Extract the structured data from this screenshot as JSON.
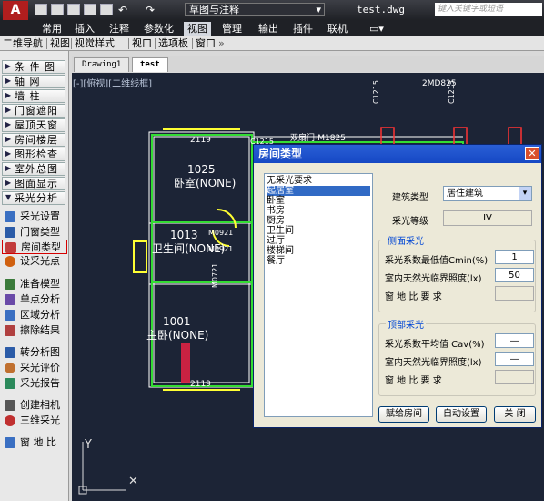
{
  "titlebar": {
    "logo": "A",
    "workspace": "草图与注释",
    "filename": "test.dwg",
    "search_placeholder": "键入关键字或短语"
  },
  "ribbon_tabs": [
    "常用",
    "插入",
    "注释",
    "参数化",
    "视图",
    "管理",
    "输出",
    "插件",
    "联机"
  ],
  "active_ribbon_tab": "视图",
  "cmdbar": {
    "items": [
      "二维导航",
      "视图",
      "视觉样式",
      "视口",
      "选项板",
      "窗口"
    ]
  },
  "left_panel": {
    "groups": [
      {
        "label": "条 件 图"
      },
      {
        "label": "轴    网"
      },
      {
        "label": "墙    柱"
      },
      {
        "label": "门窗遮阳"
      },
      {
        "label": "屋顶天窗"
      },
      {
        "label": "房间楼层"
      },
      {
        "label": "图形检查"
      },
      {
        "label": "室外总图"
      },
      {
        "label": "图面显示"
      },
      {
        "label": "采光分析"
      }
    ],
    "items": [
      {
        "label": "采光设置",
        "icon": "sun-settings-icon",
        "color": "#3a6fc2"
      },
      {
        "label": "门窗类型",
        "icon": "window-type-icon",
        "color": "#2c5ca8"
      },
      {
        "label": "房间类型",
        "icon": "room-type-icon",
        "color": "#c23b3b"
      },
      {
        "label": "设采光点",
        "icon": "point-icon",
        "color": "#d06010"
      },
      {
        "label": "准备模型",
        "icon": "model-icon",
        "color": "#3a7a3a"
      },
      {
        "label": "单点分析",
        "icon": "single-point-icon",
        "color": "#6a4aa8"
      },
      {
        "label": "区域分析",
        "icon": "area-icon",
        "color": "#3a6fc2"
      },
      {
        "label": "擦除结果",
        "icon": "eraser-icon",
        "color": "#b04040"
      },
      {
        "label": "转分析图",
        "icon": "convert-icon",
        "color": "#2c5ca8"
      },
      {
        "label": "采光评价",
        "icon": "evaluate-icon",
        "color": "#c07030"
      },
      {
        "label": "采光报告",
        "icon": "report-icon",
        "color": "#2c8a5c"
      },
      {
        "label": "创建相机",
        "icon": "camera-icon",
        "color": "#555555"
      },
      {
        "label": "三维采光",
        "icon": "3d-icon",
        "color": "#c03030"
      },
      {
        "label": "窗 地 比",
        "icon": "window-ratio-icon",
        "color": "#3a6fc2"
      }
    ]
  },
  "drawing_tabs": [
    "Drawing1",
    "test"
  ],
  "active_drawing_tab": "test",
  "view_label": "[-][俯视][二维线框]",
  "canvas_labels": {
    "room1_num": "1025",
    "room1_name": "卧室(NONE)",
    "room2_num": "1013",
    "room2_name": "卫生间(NONE)",
    "room3_num": "1001",
    "room3_name": "主卧(NONE)",
    "dim1": "2119",
    "dim2": "2119",
    "c1215": "C1215",
    "door_label": "双扇门-M1825",
    "m0921a": "M0921",
    "m0921b": "M0921",
    "m0721": "M0721",
    "top_label": "2MD825",
    "axis_y": "Y"
  },
  "dialog": {
    "title": "房间类型",
    "list_items": [
      "无采光要求",
      "起居室",
      "卧室",
      "书房",
      "厨房",
      "卫生间",
      "过厅",
      "楼梯间",
      "餐厅"
    ],
    "selected_index": 1,
    "building_type_label": "建筑类型",
    "building_type_value": "居住建筑",
    "lighting_level_label": "采光等级",
    "lighting_level_value": "IV",
    "side_group_title": "侧面采光",
    "side_cmin_label": "采光系数最低值Cmin(%)",
    "side_cmin_value": "1",
    "side_illum_label": "室内天然光临界照度(lx)",
    "side_illum_value": "50",
    "side_ratio_label": "窗 地 比 要 求",
    "side_ratio_value": "",
    "top_group_title": "顶部采光",
    "top_cav_label": "采光系数平均值 Cav(%)",
    "top_cav_value": "—",
    "top_illum_label": "室内天然光临界照度(lx)",
    "top_illum_value": "—",
    "top_ratio_label": "窗 地 比 要 求",
    "top_ratio_value": "",
    "btn_assign": "赋给房间",
    "btn_auto": "自动设置",
    "btn_close": "关 闭"
  }
}
